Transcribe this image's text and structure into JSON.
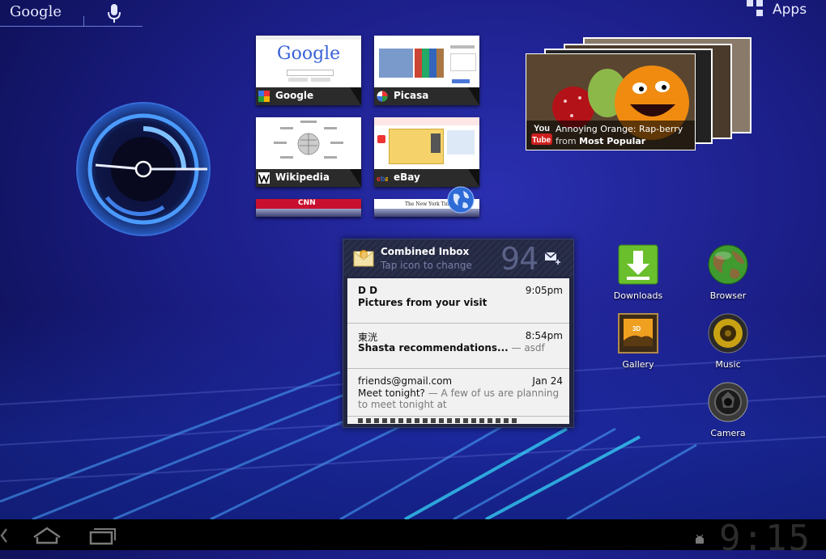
{
  "search": {
    "label": "Google"
  },
  "apps": {
    "label": "Apps"
  },
  "bookmarks": [
    {
      "label": "Google",
      "thumb_text": "Google"
    },
    {
      "label": "Picasa"
    },
    {
      "label": "Wikipedia"
    },
    {
      "label": "eBay"
    }
  ],
  "bookmark_partials": [
    {
      "thumb_text": "CNN"
    },
    {
      "thumb_text": "The New York Times"
    }
  ],
  "youtube": {
    "title": "Annoying Orange: Rap-berry",
    "from_prefix": "from",
    "from_source": "Most Popular",
    "logo_top": "You",
    "logo_bottom": "Tube"
  },
  "email": {
    "title": "Combined Inbox",
    "hint": "Tap icon to change",
    "count": "94",
    "messages": [
      {
        "from": "D D",
        "time": "9:05pm",
        "subject": "Pictures from your visit",
        "snippet": ""
      },
      {
        "from": "東洸",
        "time": "8:54pm",
        "subject": "Shasta recommendations...",
        "snippet": " — asdf"
      },
      {
        "from": "friends@gmail.com",
        "time": "Jan 24",
        "subject": "Meet tonight?",
        "snippet": " — A few of us are planning to meet tonight at"
      }
    ]
  },
  "shortcuts": {
    "downloads": "Downloads",
    "browser": "Browser",
    "gallery": "Gallery",
    "music": "Music",
    "camera": "Camera"
  },
  "status": {
    "time": "9:15"
  },
  "colors": {
    "background": "#1b1e86",
    "accent": "#3f8cff"
  }
}
